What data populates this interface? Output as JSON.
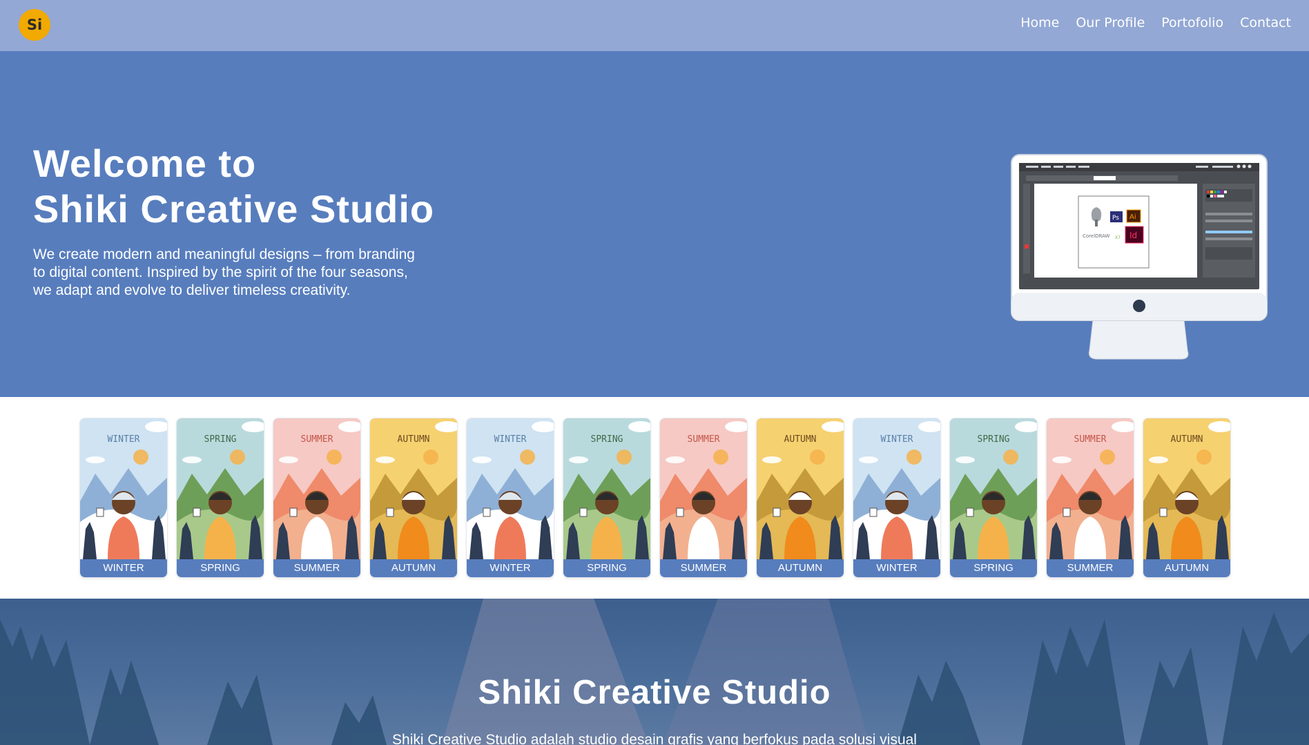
{
  "brand": {
    "logo_text": "Si",
    "logo_color": "#f2a900"
  },
  "nav": {
    "items": [
      "Home",
      "Our Profile",
      "Portofolio",
      "Contact"
    ]
  },
  "hero": {
    "title_line1": "Welcome to",
    "title_line2": "Shiki Creative Studio",
    "subtitle_line1": "We create modern and meaningful designs – from branding",
    "subtitle_line2": "to digital content. Inspired by the spirit of the four seasons,",
    "subtitle_line3": "we adapt and evolve to deliver timeless creativity.",
    "monitor_logos": {
      "corel": "CorelDRAW",
      "corel_version": "X7",
      "ps": "Ps",
      "ai": "Ai",
      "id": "Id"
    }
  },
  "seasons": {
    "cards": [
      {
        "image_title": "WINTER",
        "label": "WINTER"
      },
      {
        "image_title": "SPRING",
        "label": "SPRING"
      },
      {
        "image_title": "SUMMER",
        "label": "SUMMER"
      },
      {
        "image_title": "AUTUMN",
        "label": "AUTUMN"
      },
      {
        "image_title": "WINTER",
        "label": "WINTER"
      },
      {
        "image_title": "SPRING",
        "label": "SPRING"
      },
      {
        "image_title": "SUMMER",
        "label": "SUMMER"
      },
      {
        "image_title": "AUTUMN",
        "label": "AUTUMN"
      },
      {
        "image_title": "WINTER",
        "label": "WINTER"
      },
      {
        "image_title": "SPRING",
        "label": "SPRING"
      },
      {
        "image_title": "SUMMER",
        "label": "SUMMER"
      },
      {
        "image_title": "AUTUMN",
        "label": "AUTUMN"
      }
    ]
  },
  "about": {
    "title": "Shiki Creative Studio",
    "text": "Shiki Creative Studio adalah studio desain grafis yang berfokus pada solusi visual"
  },
  "colors": {
    "navbar": "#93a8d4",
    "hero": "#577dbd",
    "label_bar": "#577dbd",
    "winter": "#cfe3f2",
    "spring": "#b9dadd",
    "summer": "#f6c9c4",
    "autumn": "#f6d170"
  }
}
